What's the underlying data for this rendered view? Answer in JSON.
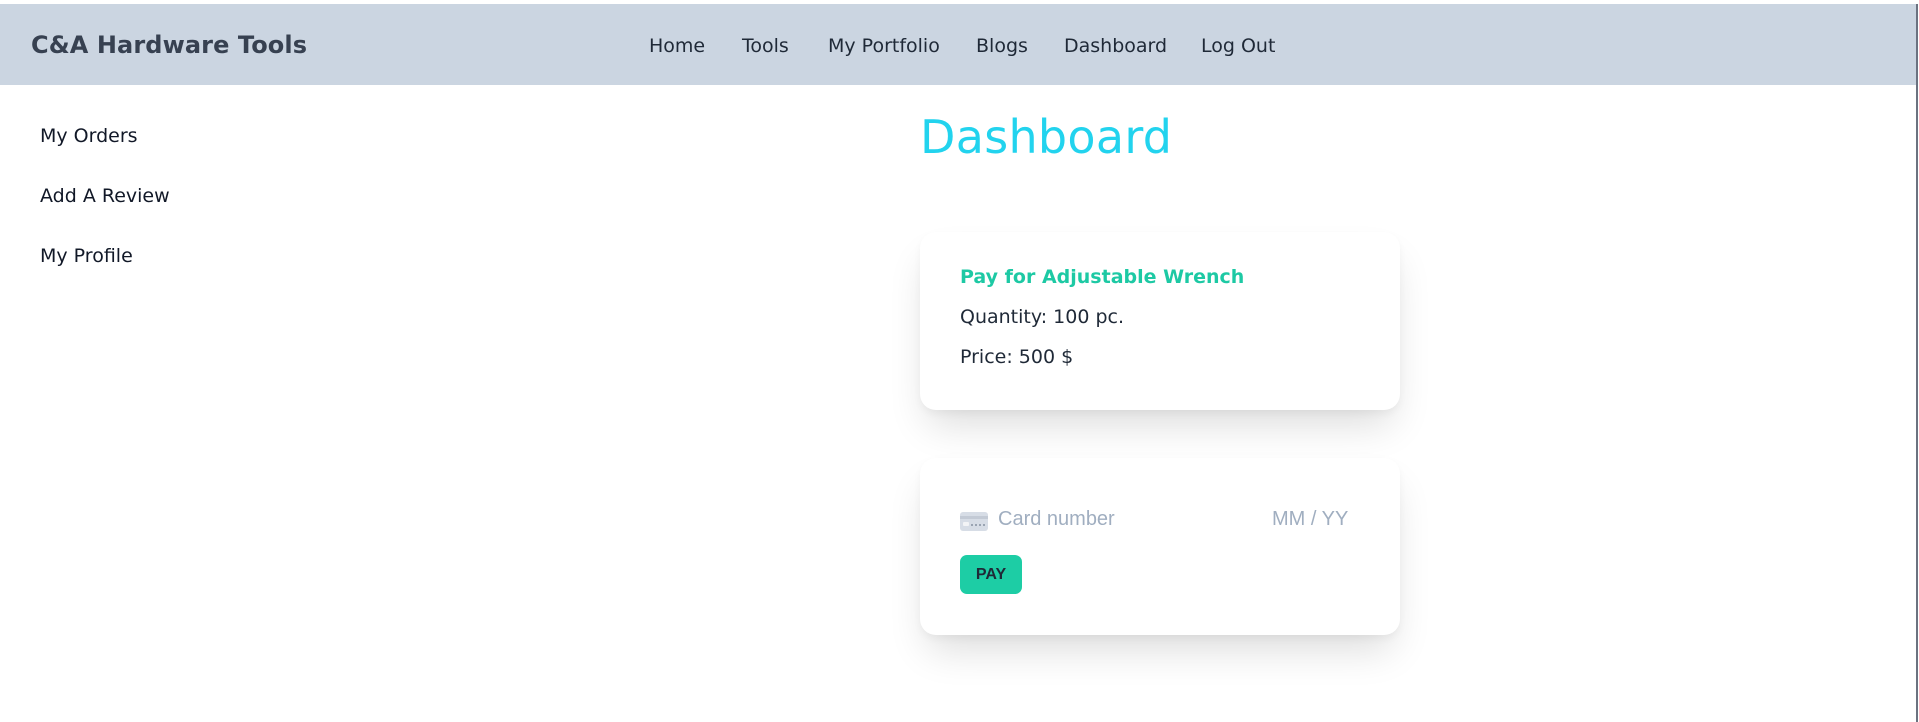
{
  "navbar": {
    "brand": "C&A Hardware Tools",
    "links": [
      {
        "label": "Home"
      },
      {
        "label": "Tools"
      },
      {
        "label": "My Portfolio"
      },
      {
        "label": "Blogs"
      },
      {
        "label": "Dashboard"
      },
      {
        "label": "Log Out"
      }
    ]
  },
  "sidebar": {
    "items": [
      {
        "label": "My Orders"
      },
      {
        "label": "Add A Review"
      },
      {
        "label": "My Profile"
      }
    ]
  },
  "main": {
    "title": "Dashboard",
    "order": {
      "title": "Pay for Adjustable Wrench",
      "quantity": "Quantity: 100 pc.",
      "price": "Price: 500 $"
    },
    "payment": {
      "card_icon": "credit-card-icon",
      "card_number_placeholder": "Card number",
      "expiry_placeholder": "MM / YY",
      "pay_label": "PAY"
    }
  },
  "colors": {
    "navbar_bg": "#cbd5e1",
    "title_accent": "#22d3ee",
    "order_title": "#1dc9a4",
    "pay_button": "#1dcda5",
    "placeholder": "#a0aec0"
  }
}
